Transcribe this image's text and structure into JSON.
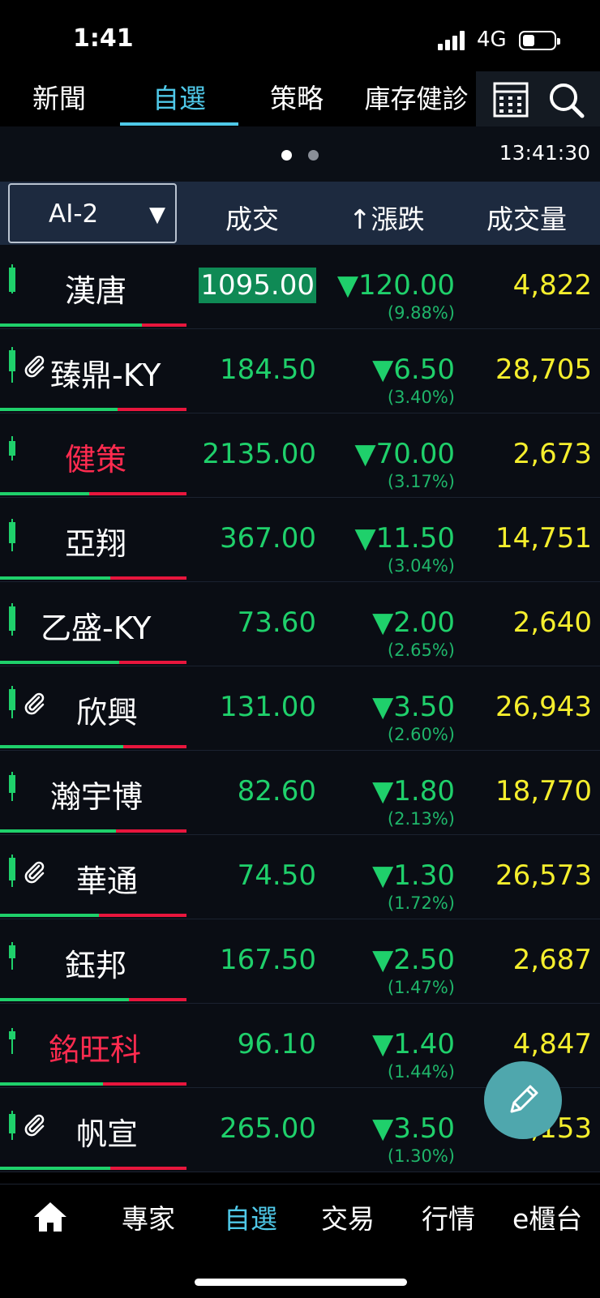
{
  "status": {
    "time": "1:41",
    "network": "4G",
    "battery_level": 0.4
  },
  "top_tabs": [
    {
      "label": "新聞",
      "active": false
    },
    {
      "label": "自選",
      "active": true
    },
    {
      "label": "策略",
      "active": false
    },
    {
      "label": "庫存健診",
      "active": false
    }
  ],
  "top_icons": [
    "grid-table-icon",
    "search-icon"
  ],
  "pager": {
    "pages": 2,
    "current": 1,
    "clock": "13:41:30"
  },
  "header": {
    "group": "AI-2",
    "caret": "▼",
    "col_price": "成交",
    "col_change": "↑漲跌",
    "col_volume": "成交量"
  },
  "stocks": [
    {
      "name": "漢唐",
      "red": false,
      "clip": false,
      "price": "1095.00",
      "highlight": true,
      "change": "▼120.00",
      "pct": "(9.88%)",
      "volume": "4,822",
      "green_ratio": 0.76
    },
    {
      "name": "臻鼎-KY",
      "red": false,
      "clip": true,
      "price": "184.50",
      "highlight": false,
      "change": "▼6.50",
      "pct": "(3.40%)",
      "volume": "28,705",
      "green_ratio": 0.63
    },
    {
      "name": "健策",
      "red": true,
      "clip": false,
      "price": "2135.00",
      "highlight": false,
      "change": "▼70.00",
      "pct": "(3.17%)",
      "volume": "2,673",
      "green_ratio": 0.48
    },
    {
      "name": "亞翔",
      "red": false,
      "clip": false,
      "price": "367.00",
      "highlight": false,
      "change": "▼11.50",
      "pct": "(3.04%)",
      "volume": "14,751",
      "green_ratio": 0.59
    },
    {
      "name": "乙盛-KY",
      "red": false,
      "clip": false,
      "price": "73.60",
      "highlight": false,
      "change": "▼2.00",
      "pct": "(2.65%)",
      "volume": "2,640",
      "green_ratio": 0.64
    },
    {
      "name": "欣興",
      "red": false,
      "clip": true,
      "price": "131.00",
      "highlight": false,
      "change": "▼3.50",
      "pct": "(2.60%)",
      "volume": "26,943",
      "green_ratio": 0.66
    },
    {
      "name": "瀚宇博",
      "red": false,
      "clip": false,
      "price": "82.60",
      "highlight": false,
      "change": "▼1.80",
      "pct": "(2.13%)",
      "volume": "18,770",
      "green_ratio": 0.62
    },
    {
      "name": "華通",
      "red": false,
      "clip": true,
      "price": "74.50",
      "highlight": false,
      "change": "▼1.30",
      "pct": "(1.72%)",
      "volume": "26,573",
      "green_ratio": 0.53
    },
    {
      "name": "鈺邦",
      "red": false,
      "clip": false,
      "price": "167.50",
      "highlight": false,
      "change": "▼2.50",
      "pct": "(1.47%)",
      "volume": "2,687",
      "green_ratio": 0.69
    },
    {
      "name": "銘旺科",
      "red": true,
      "clip": false,
      "price": "96.10",
      "highlight": false,
      "change": "▼1.40",
      "pct": "(1.44%)",
      "volume": "4,847",
      "green_ratio": 0.55
    },
    {
      "name": "帆宣",
      "red": false,
      "clip": true,
      "price": "265.00",
      "highlight": false,
      "change": "▼3.50",
      "pct": "(1.30%)",
      "volume": "3,153",
      "green_ratio": 0.59
    }
  ],
  "fab_icon": "pencil-icon",
  "bottom_nav": [
    {
      "label": "專家",
      "active": false
    },
    {
      "label": "自選",
      "active": true
    },
    {
      "label": "交易",
      "active": false
    },
    {
      "label": "行情",
      "active": false
    },
    {
      "label": "e櫃台",
      "active": false
    }
  ],
  "colors": {
    "accent": "#4fc8e8",
    "down": "#1fd06b",
    "up": "#ff2b4f",
    "volume": "#f5ee2d",
    "header_bg": "#1d2a3f"
  }
}
